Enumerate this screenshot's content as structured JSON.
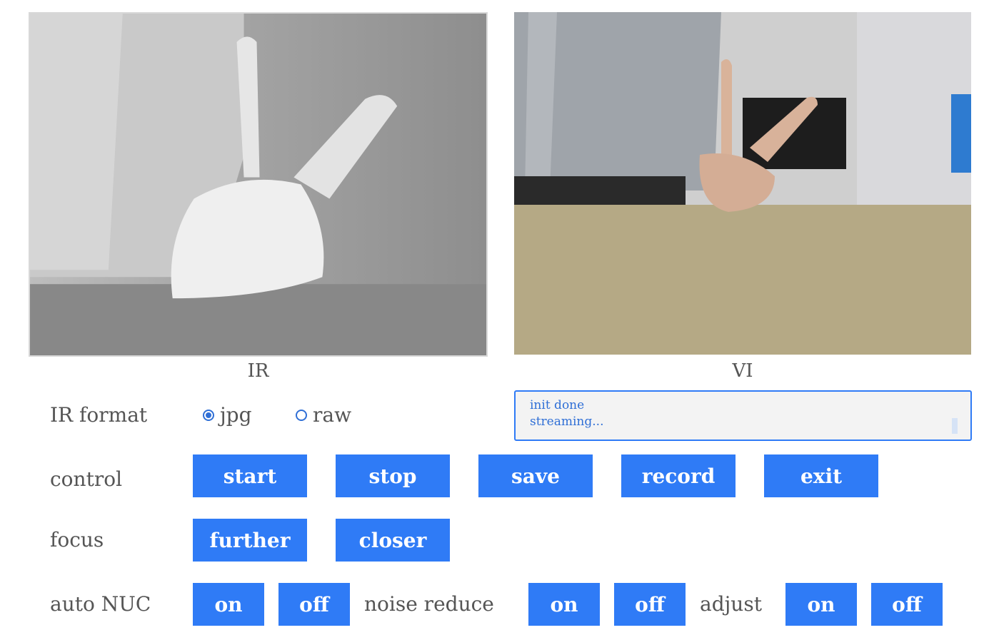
{
  "ir": {
    "caption": "IR"
  },
  "vi": {
    "caption": "VI"
  },
  "ir_format": {
    "label": "IR format",
    "options": [
      {
        "label": "jpg",
        "checked": true
      },
      {
        "label": "raw",
        "checked": false
      }
    ]
  },
  "status": {
    "lines": [
      "init done",
      "streaming..."
    ]
  },
  "control": {
    "label": "control",
    "buttons": [
      "start",
      "stop",
      "save",
      "record",
      "exit"
    ]
  },
  "focus": {
    "label": "focus",
    "buttons": [
      "further",
      "closer"
    ]
  },
  "auto_nuc": {
    "label": "auto NUC",
    "on": "on",
    "off": "off"
  },
  "noise_reduce": {
    "label": "noise reduce",
    "on": "on",
    "off": "off"
  },
  "adjust": {
    "label": "adjust",
    "on": "on",
    "off": "off"
  },
  "colors": {
    "accent": "#2f7bf6",
    "status_text": "#2f6fd6"
  }
}
